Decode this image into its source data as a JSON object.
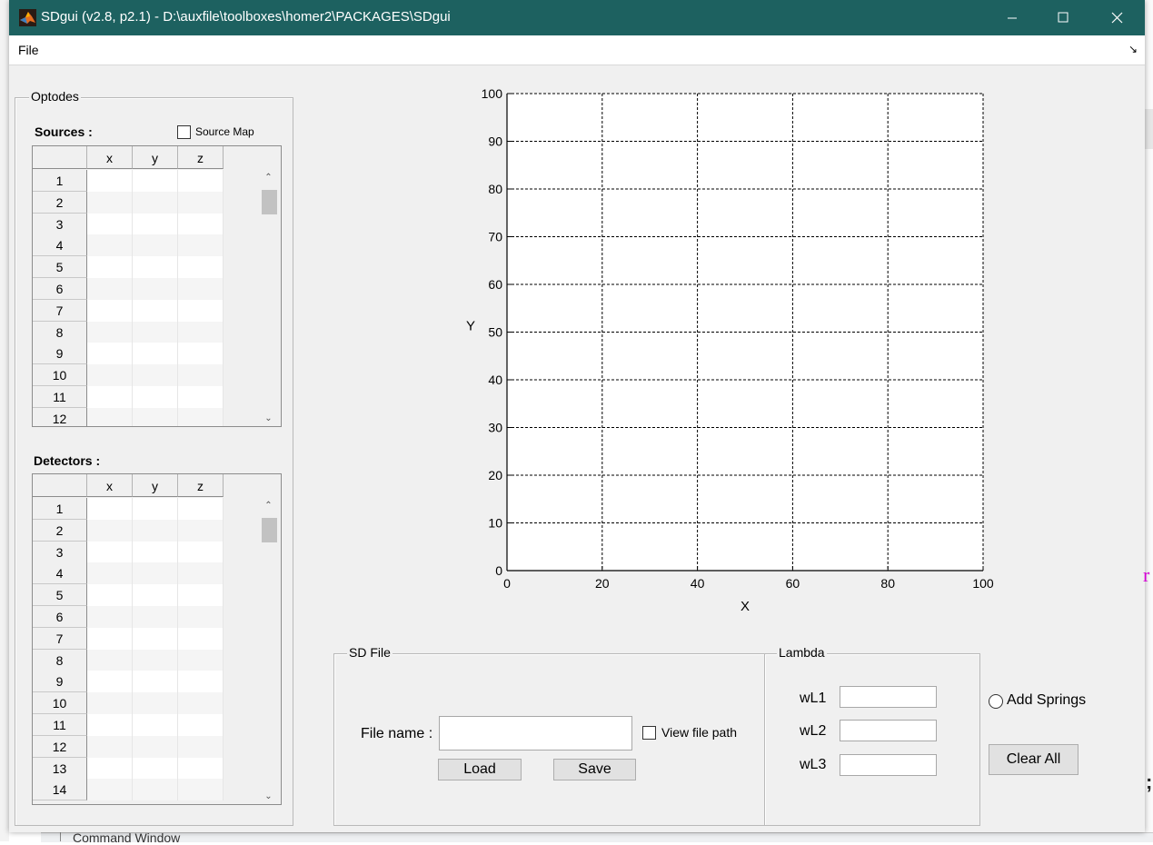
{
  "window": {
    "title": "SDgui  (v2.8, p2.1) - D:\\auxfile\\toolboxes\\homer2\\PACKAGES\\SDgui",
    "controls": {
      "minimize_icon": "minimize-icon",
      "maximize_icon": "maximize-icon",
      "close_icon": "close-icon"
    }
  },
  "menu": {
    "file": "File",
    "dock_icon": "dock-arrow-icon",
    "dock_glyph": "↘"
  },
  "optodes": {
    "group_label": "Optodes",
    "sources_label": "Sources :",
    "source_map_label": "Source Map",
    "source_map_checked": false,
    "detectors_label": "Detectors :",
    "columns": [
      "x",
      "y",
      "z"
    ],
    "sources_rows": [
      "1",
      "2",
      "3",
      "4",
      "5",
      "6",
      "7",
      "8",
      "9",
      "10",
      "11",
      "12"
    ],
    "detectors_rows": [
      "1",
      "2",
      "3",
      "4",
      "5",
      "6",
      "7",
      "8",
      "9",
      "10",
      "11",
      "12",
      "13",
      "14"
    ]
  },
  "chart_data": {
    "type": "scatter",
    "xlabel": "X",
    "ylabel": "Y",
    "xlim": [
      0,
      100
    ],
    "ylim": [
      0,
      100
    ],
    "xticks": [
      0,
      20,
      40,
      60,
      80,
      100
    ],
    "yticks": [
      0,
      10,
      20,
      30,
      40,
      50,
      60,
      70,
      80,
      90,
      100
    ],
    "grid": true,
    "grid_style": "dashed",
    "series": []
  },
  "sd_file": {
    "group_label": "SD File",
    "file_name_label": "File name :",
    "file_name_value": "",
    "view_file_path_label": "View file path",
    "view_file_path_checked": false,
    "load_label": "Load",
    "save_label": "Save"
  },
  "lambda": {
    "group_label": "Lambda",
    "fields": [
      {
        "label": "wL1",
        "value": ""
      },
      {
        "label": "wL2",
        "value": ""
      },
      {
        "label": "wL3",
        "value": ""
      }
    ]
  },
  "add_springs_label": "Add Springs",
  "clear_all_label": "Clear All",
  "background": {
    "command_window_label": "Command Window"
  }
}
